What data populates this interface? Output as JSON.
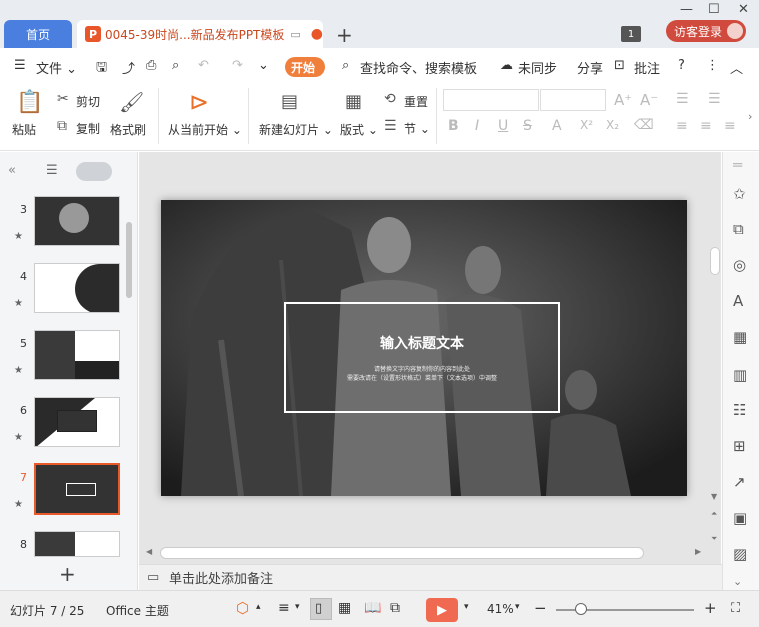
{
  "titlebar": {
    "home_tab": "首页",
    "doc_tab": "0045-39时尚...新品发布PPT模板",
    "doc_icon": "P",
    "page_count": "1",
    "login": "访客登录"
  },
  "menu": {
    "file": "文件",
    "start": "开始",
    "search": "查找命令、搜索模板",
    "sync": "未同步",
    "share": "分享",
    "comment": "批注"
  },
  "ribbon": {
    "paste": "粘贴",
    "cut": "剪切",
    "copy": "复制",
    "format_painter": "格式刷",
    "from_current": "从当前开始",
    "new_slide": "新建幻灯片",
    "layout": "版式",
    "reset": "重置",
    "section": "节"
  },
  "slides": {
    "numbers": [
      "3",
      "4",
      "5",
      "6",
      "7",
      "8"
    ],
    "active": "7"
  },
  "slide": {
    "title": "输入标题文本",
    "sub1": "请替换文字内容复制你的内容到此处",
    "sub2": "需要改请在（设置形状格式）菜单下（文本选项）中调整"
  },
  "notes": {
    "placeholder": "单击此处添加备注"
  },
  "status": {
    "slide_info": "幻灯片 7 / 25",
    "theme": "Office 主题",
    "zoom": "41%"
  }
}
